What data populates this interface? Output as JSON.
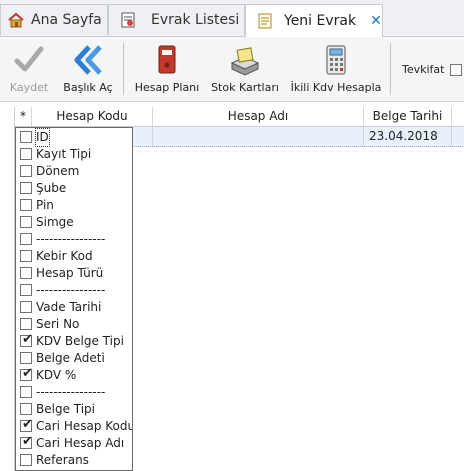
{
  "tabs": [
    {
      "label": "Ana Sayfa",
      "icon": "home-icon"
    },
    {
      "label": "Evrak Listesi",
      "icon": "document-icon"
    },
    {
      "label": "Yeni Evrak",
      "icon": "new-document-icon",
      "close": "✕"
    }
  ],
  "toolbar": {
    "save": "Kaydet",
    "header_open": "Başlık Aç",
    "account_plan": "Hesap Planı",
    "stock_cards": "Stok Kartları",
    "dual_vat": "İkili Kdv Hesapla",
    "tevkifat": "Tevkifat"
  },
  "grid": {
    "corner": "*",
    "columns": [
      "Hesap Kodu",
      "Hesap Adı",
      "Belge Tarihi"
    ],
    "row": {
      "date": "23.04.2018"
    }
  },
  "column_chooser": [
    {
      "label": "ID",
      "checked": false
    },
    {
      "label": "Kayıt Tipi",
      "checked": false
    },
    {
      "label": "Dönem",
      "checked": false
    },
    {
      "label": "Şube",
      "checked": false
    },
    {
      "label": "Pin",
      "checked": false
    },
    {
      "label": "Simge",
      "checked": false
    },
    {
      "label": "----------------",
      "checked": false
    },
    {
      "label": "Kebir Kod",
      "checked": false
    },
    {
      "label": "Hesap Türü",
      "checked": false
    },
    {
      "label": "----------------",
      "checked": false
    },
    {
      "label": "Vade Tarihi",
      "checked": false
    },
    {
      "label": "Seri No",
      "checked": false
    },
    {
      "label": "KDV Belge Tipi",
      "checked": true
    },
    {
      "label": "Belge Adeti",
      "checked": false
    },
    {
      "label": "KDV %",
      "checked": true
    },
    {
      "label": "----------------",
      "checked": false
    },
    {
      "label": "Belge Tipi",
      "checked": false
    },
    {
      "label": "Cari Hesap Kodu",
      "checked": true
    },
    {
      "label": "Cari Hesap Adı",
      "checked": true
    },
    {
      "label": "Referans",
      "checked": false
    }
  ],
  "colors": {
    "accent": "#1a73c8",
    "selected_row": "#e7f0fb"
  }
}
